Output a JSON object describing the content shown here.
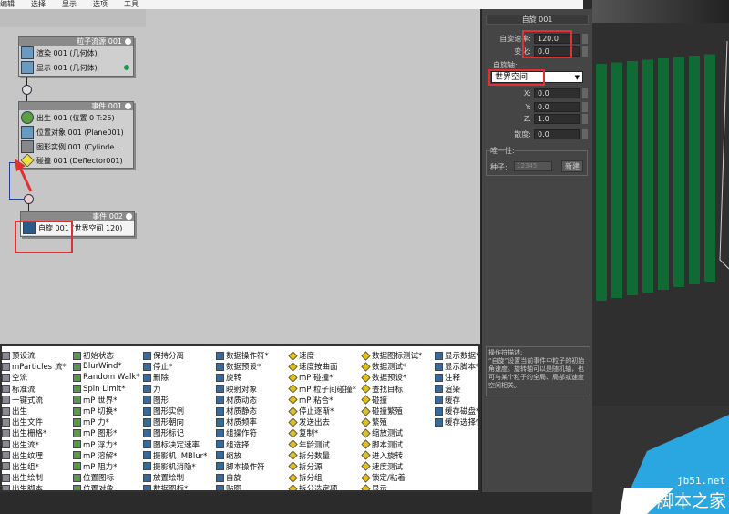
{
  "menu": [
    "编辑",
    "选择",
    "显示",
    "选项",
    "工具"
  ],
  "source_node": {
    "title": "粒子流源 001",
    "rows": [
      "渲染 001 (几何体)",
      "显示 001 (几何体)"
    ]
  },
  "event1": {
    "title": "事件 001",
    "rows": [
      "出生 001 (位置 0 T:25)",
      "位置对象 001 (Plane001)",
      "图形实例 001 (Cylinde...",
      "碰撞 001 (Deflector001)"
    ]
  },
  "event2": {
    "title": "事件 002",
    "row_name": "自旋 001",
    "row_detail": "(世界空间 120)"
  },
  "panel": {
    "title": "自旋 001",
    "spin_rate_label": "自旋速率:",
    "spin_rate": "120.0",
    "variation_label": "变化:",
    "variation": "0.0",
    "axis_label": "自旋轴:",
    "axis_value": "世界空间",
    "x_label": "X:",
    "x": "0.0",
    "y_label": "Y:",
    "y": "0.0",
    "z_label": "Z:",
    "z": "1.0",
    "divergence_label": "散度:",
    "divergence": "0.0",
    "uniqueness_label": "唯一性:",
    "seed_label": "种子:",
    "seed": "12345",
    "new_label": "新建",
    "desc_title": "操作符描述:",
    "desc_text": "“自旋”设置当前事件中粒子的初始角速度。旋转轴可以是随机轴，也可与某个粒子的全局、局部或速度空间相关。"
  },
  "depot": [
    [
      "预设流",
      "mParticles 流*",
      "空流",
      "标准流",
      "一键式流",
      "出生",
      "出生文件",
      "出生栅格*",
      "出生流*",
      "出生纹理",
      "出生组*",
      "出生绘制",
      "出生脚本"
    ],
    [
      "初始状态",
      "BlurWind*",
      "Random Walk*",
      "Spin Limit*",
      "mP 世界*",
      "mP 切换*",
      "mP 力*",
      "mP 图形*",
      "mP 浮力*",
      "mP 溶解*",
      "mP 阻力*",
      "位置图标",
      "位置对象"
    ],
    [
      "保持分离",
      "停止*",
      "删除",
      "力",
      "图形",
      "图形实例",
      "图形朝向",
      "图形标记",
      "图标决定速率",
      "摄影机 IMBlur*",
      "摄影机消隐*",
      "放置绘制",
      "数据图标*"
    ],
    [
      "数据操作符*",
      "数据预设*",
      "旋转",
      "映射对象",
      "材质动态",
      "材质静态",
      "材质频率",
      "组操作符",
      "组选择",
      "缩放",
      "脚本操作符",
      "自旋",
      "贴图"
    ],
    [
      "速度",
      "速度按曲面",
      "mP 碰撞*",
      "mP 粒子间碰撞*",
      "mP 粘合*",
      "停止逐渐*",
      "发送出去",
      "复制*",
      "年龄测试",
      "拆分数量",
      "拆分源",
      "拆分组",
      "拆分选定项"
    ],
    [
      "数据图标测试*",
      "数据测试*",
      "数据预设*",
      "查找目标",
      "碰撞",
      "碰撞繁殖",
      "繁殖",
      "缩放测试",
      "脚本测试",
      "进入旋转",
      "速度测试",
      "锁定/粘着",
      "显示"
    ],
    [
      "显示数据*",
      "显示脚本*",
      "注释",
      "渲染",
      "缓存",
      "缓存磁盘*",
      "缓存选择性"
    ]
  ],
  "watermark": {
    "url": "jb51.net",
    "name": "脚本之家"
  },
  "colors": {
    "highlight": "#e03030",
    "panel": "#454545",
    "canvas": "#c6c6c6",
    "cylinders": "#0f6a34"
  }
}
